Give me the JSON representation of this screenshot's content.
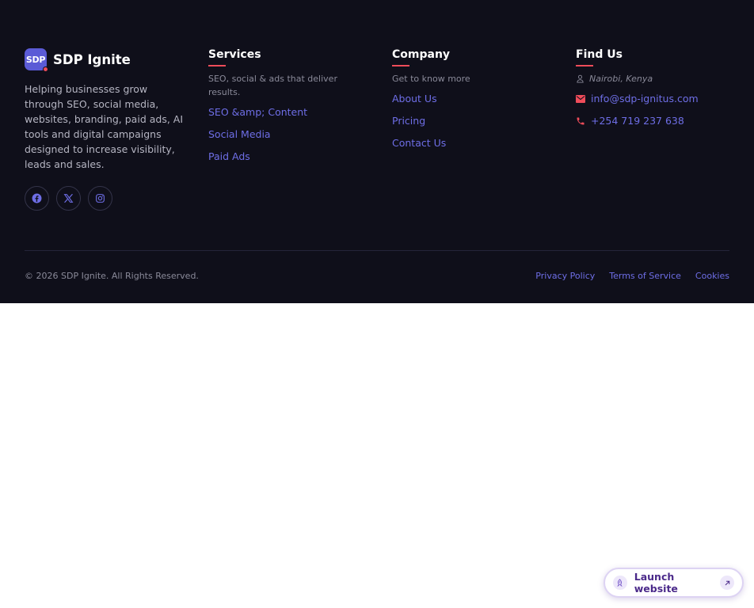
{
  "brand": {
    "logo_text": "SDP",
    "name": "SDP Ignite",
    "description": "Helping businesses grow through SEO, social media, websites, branding, paid ads, AI tools and digital campaigns designed to increase visibility, leads and sales.",
    "socials": [
      {
        "icon": "facebook-icon"
      },
      {
        "icon": "x-twitter-icon"
      },
      {
        "icon": "instagram-icon"
      }
    ]
  },
  "services": {
    "title": "Services",
    "subtitle": "SEO, social & ads that deliver results.",
    "links": [
      "SEO &amp; Content",
      "Social Media",
      "Paid Ads"
    ]
  },
  "company": {
    "title": "Company",
    "subtitle": "Get to know more",
    "links": [
      "About Us",
      "Pricing",
      "Contact Us"
    ]
  },
  "find_us": {
    "title": "Find Us",
    "location": "Nairobi, Kenya",
    "email": "info@sdp-ignitus.com",
    "phone": "+254 719 237 638"
  },
  "bottom": {
    "copyright": "© 2026 SDP Ignite. All Rights Reserved.",
    "legal_links": [
      "Privacy Policy",
      "Terms of Service",
      "Cookies"
    ]
  },
  "launch": {
    "label": "Launch website"
  },
  "colors": {
    "footer_bg": "#0f0f1a",
    "accent_link": "#6e6ee6",
    "accent_red": "#ef4c5a",
    "brand_badge": "#5b5bd6"
  }
}
